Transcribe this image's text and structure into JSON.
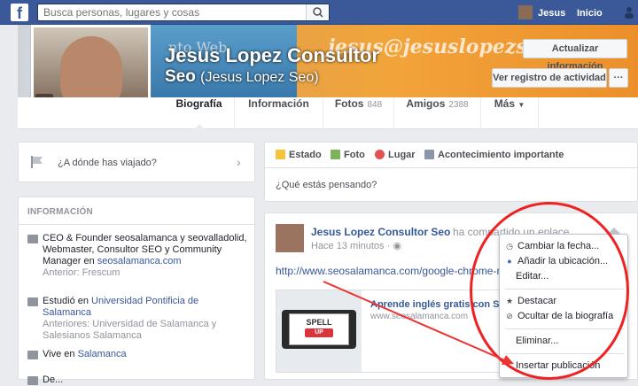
{
  "topbar": {
    "logo": "f",
    "search_placeholder": "Busca personas, lugares y cosas",
    "user_name": "Jesus",
    "home_label": "Inicio"
  },
  "cover": {
    "watermark_left": "nto Web",
    "watermark_right": "jesus@jesuslopezseo.com",
    "name_line1": "Jesus Lopez Consultor",
    "name_line2": "Seo",
    "alt_name": "(Jesus Lopez Seo)",
    "update_info_button": "Actualizar información",
    "activity_log_button": "Ver registro de actividad",
    "more_button": "···"
  },
  "tabs": [
    {
      "label": "Biografía",
      "count": ""
    },
    {
      "label": "Información",
      "count": ""
    },
    {
      "label": "Fotos",
      "count": "848"
    },
    {
      "label": "Amigos",
      "count": "2388"
    },
    {
      "label": "Más",
      "count": ""
    }
  ],
  "travel": {
    "label": "¿A dónde has viajado?"
  },
  "info": {
    "heading": "INFORMACIÓN",
    "work": {
      "text": "CEO & Founder seosalamanca y seovalladolid, Webmaster, Consultor SEO y Community Manager en",
      "link": "seosalamanca.com",
      "sub": "Anterior: Frescum"
    },
    "study": {
      "prefix": "Estudió en",
      "link": "Universidad Pontificia de Salamanca",
      "sub": "Anteriores: Universidad de Salamanca y Salesianos Salamanca"
    },
    "lives": {
      "prefix": "Vive en",
      "link": "Salamanca"
    },
    "partial": "De..."
  },
  "composer": {
    "tabs": [
      "Estado",
      "Foto",
      "Lugar",
      "Acontecimiento importante"
    ],
    "placeholder": "¿Qué estás pensando?"
  },
  "post": {
    "author": "Jesus Lopez Consultor Seo",
    "action": "ha compartido un enlace.",
    "time": "Hace 13 minutos",
    "link": "http://www.seosalamanca.com/google-chrome-me",
    "card_title": "Aprende inglés gratis con Spell",
    "card_url": "www.seosalamanca.com",
    "thumb_text": "SPELL",
    "thumb_badge": "UP"
  },
  "menu": {
    "items": [
      {
        "label": "Cambiar la fecha...",
        "icon": "clock-icon"
      },
      {
        "label": "Añadir la ubicación...",
        "icon": "pin-icon"
      },
      {
        "label": "Editar...",
        "icon": ""
      },
      {
        "label": "Destacar",
        "icon": "star-icon"
      },
      {
        "label": "Ocultar de la biografía",
        "icon": "hide-icon"
      },
      {
        "label": "Eliminar...",
        "icon": ""
      },
      {
        "label": "Insertar publicación",
        "icon": ""
      }
    ]
  },
  "colors": {
    "brand": "#3b5998",
    "link": "#365899",
    "annotation": "#ee2222"
  }
}
